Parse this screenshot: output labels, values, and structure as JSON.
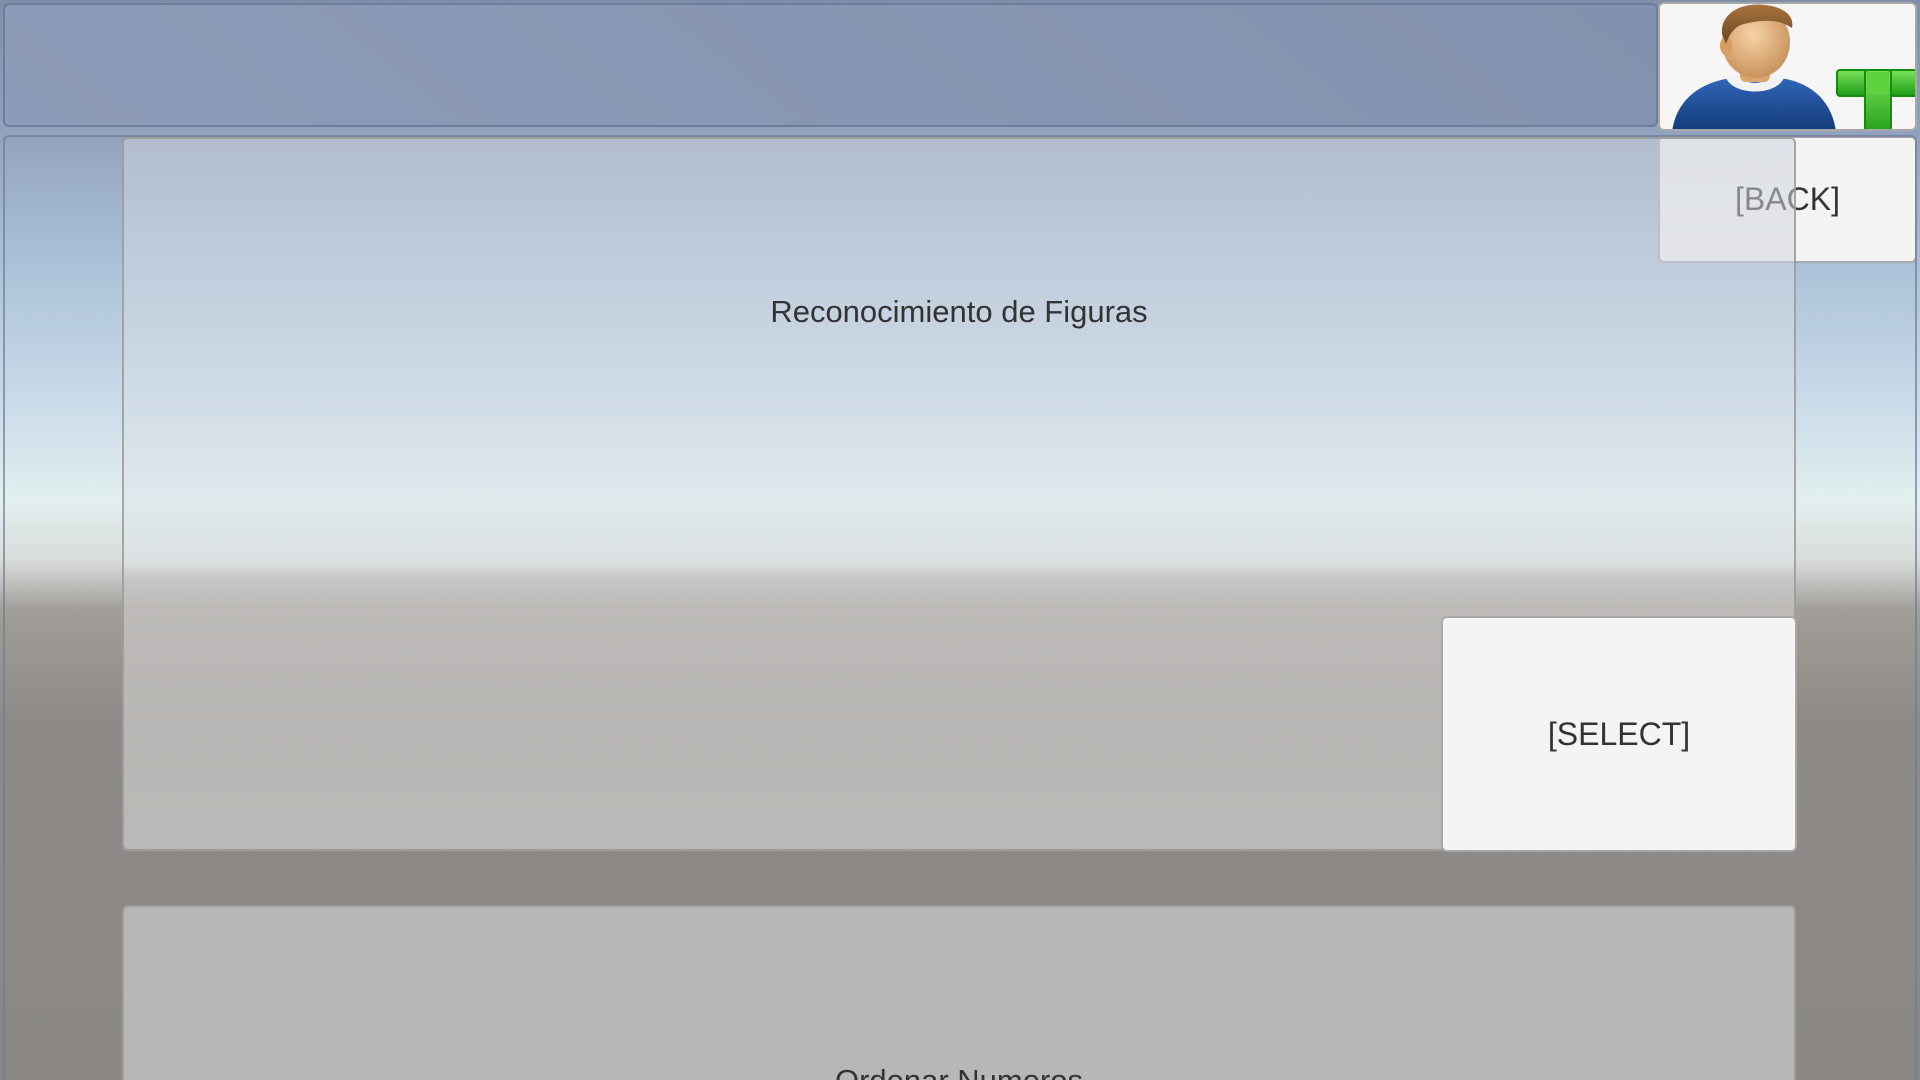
{
  "header": {
    "add_user_icon": "add-user-icon",
    "back_label": "[BACK]"
  },
  "games": [
    {
      "title": "Reconocimiento de Figuras",
      "select_label": "[SELECT]"
    },
    {
      "title": "Ordenar Numeros"
    }
  ],
  "colors": {
    "button_bg": "#f4f4f4",
    "text": "#333333",
    "plus_green": "#3cbf28"
  }
}
